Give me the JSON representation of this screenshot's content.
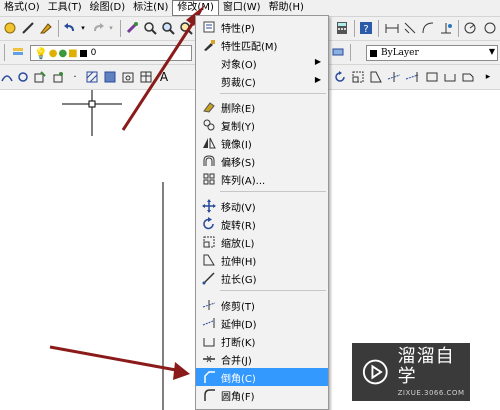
{
  "menubar": {
    "items": [
      "格式(O)",
      "工具(T)",
      "绘图(D)",
      "标注(N)",
      "修改(M)",
      "窗口(W)",
      "帮助(H)"
    ]
  },
  "toolbar": {
    "layer_name": "0",
    "linetype_value": "ByLayer"
  },
  "modify_menu": {
    "items": [
      {
        "label": "特性(P)",
        "icon": "properties-icon",
        "submenu": false
      },
      {
        "label": "特性匹配(M)",
        "icon": "match-properties-icon",
        "submenu": false
      },
      {
        "label": "对象(O)",
        "icon": "",
        "submenu": true
      },
      {
        "label": "剪裁(C)",
        "icon": "",
        "submenu": true
      },
      {
        "label": "删除(E)",
        "icon": "erase-icon",
        "submenu": false
      },
      {
        "label": "复制(Y)",
        "icon": "copy-icon",
        "submenu": false
      },
      {
        "label": "镜像(I)",
        "icon": "mirror-icon",
        "submenu": false
      },
      {
        "label": "偏移(S)",
        "icon": "offset-icon",
        "submenu": false
      },
      {
        "label": "阵列(A)...",
        "icon": "array-icon",
        "submenu": false
      },
      {
        "label": "移动(V)",
        "icon": "move-icon",
        "submenu": false
      },
      {
        "label": "旋转(R)",
        "icon": "rotate-icon",
        "submenu": false
      },
      {
        "label": "缩放(L)",
        "icon": "scale-icon",
        "submenu": false
      },
      {
        "label": "拉伸(H)",
        "icon": "stretch-icon",
        "submenu": false
      },
      {
        "label": "拉长(G)",
        "icon": "lengthen-icon",
        "submenu": false
      },
      {
        "label": "修剪(T)",
        "icon": "trim-icon",
        "submenu": false
      },
      {
        "label": "延伸(D)",
        "icon": "extend-icon",
        "submenu": false
      },
      {
        "label": "打断(K)",
        "icon": "break-icon",
        "submenu": false
      },
      {
        "label": "合并(J)",
        "icon": "join-icon",
        "submenu": false
      },
      {
        "label": "倒角(C)",
        "icon": "chamfer-icon",
        "submenu": false,
        "highlighted": true
      },
      {
        "label": "圆角(F)",
        "icon": "fillet-icon",
        "submenu": false
      }
    ]
  },
  "watermark": {
    "title": "溜溜自学",
    "url": "ZIXUE.3066.COM"
  },
  "colors": {
    "highlight": "#3399ff",
    "arrow": "#8b1a1a",
    "watermark_bg": "#3a3a3a"
  }
}
